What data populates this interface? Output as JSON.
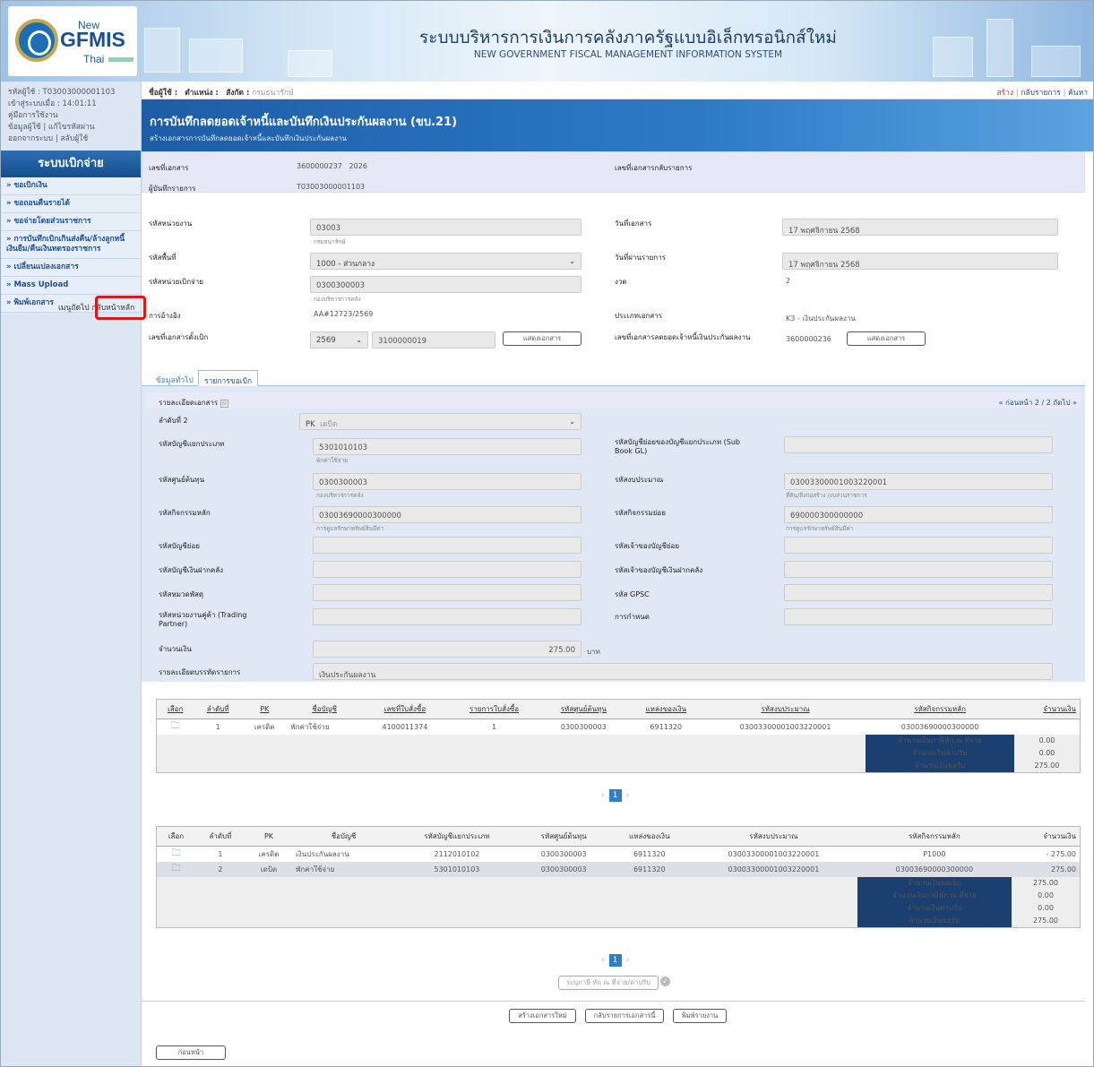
{
  "header": {
    "logo_new": "New",
    "logo_gfmis": "GFMIS",
    "logo_thai": "Thai",
    "title": "ระบบบริหารการเงินการคลังภาครัฐแบบอิเล็กทรอนิกส์ใหม่",
    "subtitle": "NEW GOVERNMENT FISCAL MANAGEMENT INFORMATION SYSTEM"
  },
  "user": {
    "line1": "รหัสผู้ใช้ : T03003000001103",
    "line2": "เข้าสู่ระบบเมื่อ : 14:01:11",
    "manual": "คู่มือการใช้งาน",
    "profile": "ข้อมูลผู้ใช้",
    "change_pw": "แก้ไขรหัสผ่าน",
    "logout": "ออกจากระบบ",
    "switch_user": "สลับผู้ใช้"
  },
  "sidebar": {
    "title": "ระบบเบิกจ่าย",
    "items": [
      "» ขอเบิกเงิน",
      "» ขอถอนคืนรายได้",
      "» ขอจ่ายโดยส่วนราชการ",
      "» การบันทึกเบิกเกินส่งคืน/ล้างลูกหนี้เงินยืม/คืนเงินทดรองราชการ",
      "» เปลี่ยนแปลงเอกสาร",
      "» Mass Upload",
      "» พิมพ์เอกสาร"
    ],
    "menu_link": "เมนูถัดไป",
    "home_link": "กลับหน้าหลัก"
  },
  "topbar": {
    "user_label": "ชื่อผู้ใช้ :",
    "position_label": "ตำแหน่ง :",
    "org_label": "สังกัด :",
    "org_value": "กรมธนารักษ์",
    "create": "สร้าง",
    "back_list": "กลับรายการ",
    "search": "ค้นหา"
  },
  "page": {
    "title": "การบันทึกลดยอดเจ้าหนี้และบันทึกเงินประกันผลงาน (ขบ.21)",
    "subtitle": "สร้างเอกสารการบันทึกลดยอดเจ้าหนี้และบันทึกเงินประกันผลงาน"
  },
  "doc": {
    "doc_no_label": "เลขที่เอกสาร",
    "doc_no": "3600000237",
    "doc_year": "2026",
    "reverse_label": "เลขที่เอกสารกลับรายการ",
    "recorder_label": "ผู้บันทึกรายการ",
    "recorder": "T03003000001103"
  },
  "form": {
    "dept_label": "รหัสหน่วยงาน",
    "dept": "03003",
    "dept_name": "กรมธนารักษ์",
    "docdate_label": "วันที่เอกสาร",
    "docdate": "17 พฤศจิกายน 2568",
    "area_label": "รหัสพื้นที่",
    "area": "1000 - ส่วนกลาง",
    "postdate_label": "วันที่ผ่านรายการ",
    "postdate": "17 พฤศจิกายน 2568",
    "payunit_label": "รหัสหน่วยเบิกจ่าย",
    "payunit": "0300300003",
    "payunit_name": "กองบริหารการคลัง",
    "period_label": "งวด",
    "period": "2",
    "ref_label": "การอ้างอิง",
    "ref": "AA#12723/2569",
    "doctype_label": "ประเภทเอกสาร",
    "doctype": "K3 - เงินประกันผลงาน",
    "reqno_label": "เลขที่เอกสารตั้งเบิก",
    "req_year": "2569",
    "req_no": "3100000019",
    "show_doc": "แสดงเอกสาร",
    "reduce_label": "เลขที่เอกสารลดยอดเจ้าหนี้เงินประกันผลงาน",
    "reduce_no": "3600000236"
  },
  "tabs": {
    "general": "ข้อมูลทั่วไป",
    "items": "รายการขอเบิก"
  },
  "detail": {
    "title": "รายละเอียดเอกสาร",
    "nav": "« ก่อนหน้า 2 / 2 ถัดไป »",
    "seq_label": "ลำดับที่ 2",
    "pk": "PK",
    "pk_value": "เดบิต",
    "gl_label": "รหัสบัญชีแยกประเภท",
    "gl": "5301010103",
    "gl_name": "พักค่าใช้จ่าย",
    "subgl_label": "รหัสบัญชีย่อยของบัญชีแยกประเภท (Sub Book GL)",
    "cost_label": "รหัสศูนย์ต้นทุน",
    "cost": "0300300003",
    "cost_name": "กองบริหารการคลัง",
    "budget_label": "รหัสงบประมาณ",
    "budget": "03003300001003220001",
    "budget_name": "ที่ดิน/สิ่งก่อสร้าง /งบส่วนราชการ",
    "act_label": "รหัสกิจกรรมหลัก",
    "act": "03003690000300000",
    "act_name": "การดูแลรักษาทรัพย์สินมีค่า",
    "subact_label": "รหัสกิจกรรมย่อย",
    "subact": "690000300000000",
    "subact_name": "การดูแลรักษาทรัพย์สินมีค่า",
    "subacc_label": "รหัสบัญชีย่อย",
    "subowner_label": "รหัสเจ้าของบัญชีย่อย",
    "bank_label": "รหัสบัญชีเงินฝากคลัง",
    "bankowner_label": "รหัสเจ้าของบัญชีเงินฝากคลัง",
    "goods_label": "รหัสหมวดพัสดุ",
    "gpsc_label": "รหัส GPSC",
    "tp_label": "รหัสหน่วยงานคู่ค้า (Trading Partner)",
    "due_label": "การกำหนด",
    "amount_label": "จำนวนเงิน",
    "amount": "275.00",
    "baht": "บาท",
    "desc_label": "รายละเอียดบรรทัดรายการ",
    "desc": "เงินประกันผลงาน"
  },
  "table1": {
    "headers": [
      "เลือก",
      "ลำดับที่",
      "PK",
      "ชื่อบัญชี",
      "เลขที่ใบสั่งซื้อ",
      "รายการใบสั่งซื้อ",
      "รหัสศูนย์ต้นทุน",
      "แหล่งของเงิน",
      "รหัสงบประมาณ",
      "รหัสกิจกรรมหลัก",
      "จำนวนเงิน"
    ],
    "rows": [
      [
        "1",
        "เครดิต",
        "พักค่าใช้จ่าย",
        "4100011374",
        "1",
        "0300300003",
        "6911320",
        "03003300001003220001",
        "03003690000300000",
        ""
      ]
    ],
    "summary": [
      [
        "จำนวนเงินภาษีหัก ณ ที่จ่าย",
        "0.00"
      ],
      [
        "จำนวนเงินค่าปรับ",
        "0.00"
      ],
      [
        "จำนวนเงินขอรับ",
        "275.00"
      ]
    ],
    "page": "1"
  },
  "table2": {
    "headers": [
      "เลือก",
      "ลำดับที่",
      "PK",
      "ชื่อบัญชี",
      "รหัสบัญชีแยกประเภท",
      "รหัสศูนย์ต้นทุน",
      "แหล่งของเงิน",
      "รหัสงบประมาณ",
      "รหัสกิจกรรมหลัก",
      "จำนวนเงิน"
    ],
    "rows": [
      [
        "1",
        "เครดิต",
        "เงินประกันผลงาน",
        "2112010102",
        "0300300003",
        "6911320",
        "03003300001003220001",
        "P1000",
        "- 275.00"
      ],
      [
        "2",
        "เดบิต",
        "พักค่าใช้จ่าย",
        "5301010103",
        "0300300003",
        "6911320",
        "03003300001003220001",
        "03003690000300000",
        "275.00"
      ]
    ],
    "summary": [
      [
        "จำนวนเงินขอเบิก",
        "275.00"
      ],
      [
        "จำนวนเงินภาษีหัก ณ ที่จ่าย",
        "0.00"
      ],
      [
        "จำนวนเงินค่าปรับ",
        "0.00"
      ],
      [
        "จำนวนเงินขอรับ",
        "275.00"
      ]
    ],
    "page": "1"
  },
  "actions": {
    "tax_btn": "ระบุภาษี หัก ณ ที่จ่าย/ค่าปรับ",
    "new_doc": "สร้างเอกสารใหม่",
    "back_doc": "กลับรายการเอกสารนี้",
    "print": "พิมพ์รายงาน",
    "prev": "ก่อนหน้า"
  }
}
